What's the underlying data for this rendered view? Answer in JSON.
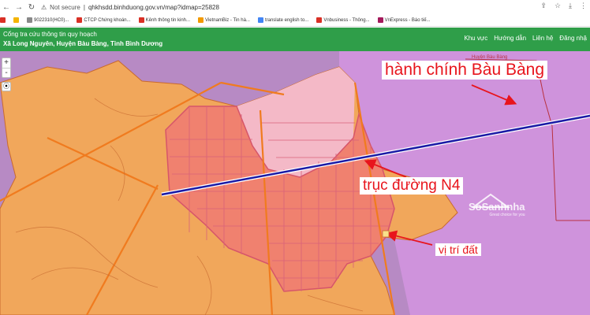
{
  "browser": {
    "insecure_label": "Not secure",
    "url": "qhkhsdd.binhduong.gov.vn/map?idmap=25828"
  },
  "bookmarks": [
    {
      "label": "",
      "color": "#d93025"
    },
    {
      "label": "",
      "color": "#f4b400"
    },
    {
      "label": "9022310(HC0)...",
      "color": "#888888"
    },
    {
      "label": "CTCP Chứng khoán...",
      "color": "#d93025"
    },
    {
      "label": "Kênh thông tin kinh...",
      "color": "#d93025"
    },
    {
      "label": "VietnamBiz - Tin hà...",
      "color": "#f29900"
    },
    {
      "label": "translate english to...",
      "color": "#4285f4"
    },
    {
      "label": "Vnbusiness - Thông...",
      "color": "#d93025"
    },
    {
      "label": "VnExpress - Báo tiế...",
      "color": "#a3195b"
    }
  ],
  "header": {
    "portal_title": "Cổng tra cứu thông tin quy hoạch",
    "location": "Xã Long Nguyên, Huyện Bàu Bàng, Tỉnh Bình Dương",
    "nav": [
      "Khu vực",
      "Hướng dẫn",
      "Liên hệ",
      "Đăng nhậ"
    ]
  },
  "map": {
    "zoom_in": "+",
    "zoom_out": "-",
    "locate": "⦿",
    "district_label": "Huyện Bàu Bàng",
    "annotations": {
      "admin": "hành chính Bàu Bàng",
      "road": "trục đường N4",
      "plot": "vị trí đất"
    },
    "watermark": "SoSanhnha",
    "watermark_sub": "Great choice for you",
    "colors": {
      "zone_purple": "#c98fd8",
      "land_orange": "#f1a75b",
      "plan_red": "#f0816f",
      "road": "#1a1aa6",
      "arrow": "#e8141c"
    }
  }
}
